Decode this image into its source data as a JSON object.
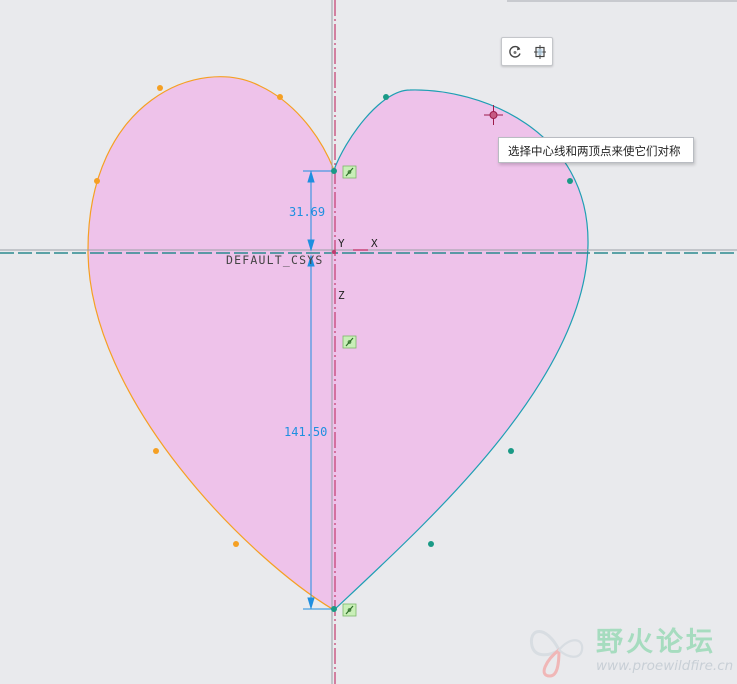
{
  "sketch": {
    "csys_label": "DEFAULT_CSYS",
    "axis_y_label": "Y",
    "axis_x_label": "X",
    "axis_z_label": "Z",
    "dim_top_value": "31.69",
    "dim_bottom_value": "141.50"
  },
  "tooltip": {
    "text": "选择中心线和两顶点来使它们对称"
  },
  "toolbar": {
    "rotate_icon": "rotate-view-icon",
    "orient_icon": "sketch-orientation-icon"
  },
  "watermark": {
    "brand": "野火论坛",
    "url": "www.proewildfire.cn"
  },
  "colors": {
    "fill": "#eec2ea",
    "left_curve": "#f5a023",
    "right_curve": "#1e9fb3",
    "dimension": "#1f8fe0",
    "centerline": "#c23b6e",
    "hline": "#2a8a8e"
  }
}
